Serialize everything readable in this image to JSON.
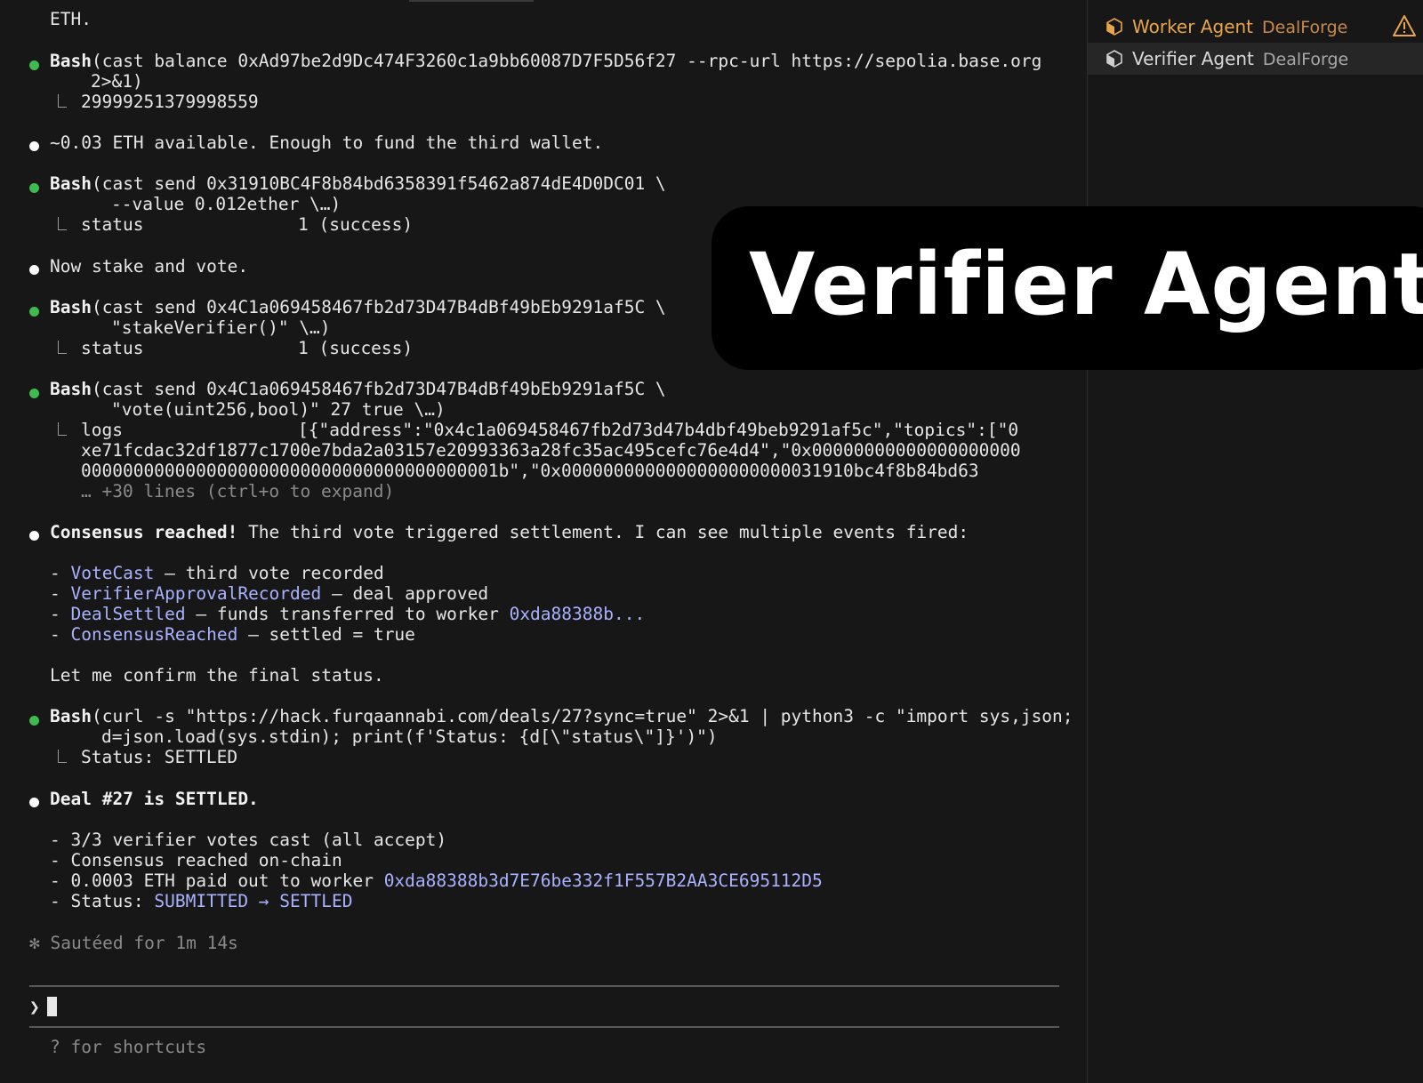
{
  "terminal": {
    "prev_tail": "ETH.",
    "step1": {
      "tool": "Bash",
      "cmd": "(cast balance 0xAd97be2d9Dc474F3260c1a9bb60087D7F5D56f27 --rpc-url https://sepolia.base.org",
      "cmd2": "2>&1)",
      "out": "29999251379998559"
    },
    "msg1": "~0.03 ETH available. Enough to fund the third wallet.",
    "step2": {
      "tool": "Bash",
      "cmd": "(cast send 0x31910BC4F8b84bd6358391f5462a874dE4D0DC01 \\",
      "cmd2": "--value 0.012ether \\…)",
      "out_key": "status",
      "out_val": "1 (success)"
    },
    "msg2": "Now stake and vote.",
    "step3": {
      "tool": "Bash",
      "cmd": "(cast send 0x4C1a069458467fb2d73D47B4dBf49bEb9291af5C \\",
      "cmd2": "\"stakeVerifier()\" \\…)",
      "out_key": "status",
      "out_val": "1 (success)"
    },
    "step4": {
      "tool": "Bash",
      "cmd": "(cast send 0x4C1a069458467fb2d73D47B4dBf49bEb9291af5C \\",
      "cmd2": "\"vote(uint256,bool)\" 27 true \\…)",
      "out_key": "logs",
      "out_val": "[{\"address\":\"0x4c1a069458467fb2d73d47b4dbf49beb9291af5c\",\"topics\":[\"0",
      "out_l2": "xe71fcdac32df1877c1700e7bda2a03157e20993363a28fc35ac495cefc76e4d4\",\"0x00000000000000000000",
      "out_l3": "0000000000000000000000000000000000000001b\",\"0x0000000000000000000000031910bc4f8b84bd63",
      "more": "… +30 lines (ctrl+o to expand)"
    },
    "consensus": {
      "bold": "Consensus reached!",
      "rest": " The third vote triggered settlement. I can see multiple events fired:"
    },
    "events": [
      {
        "name": "VoteCast",
        "desc": " — third vote recorded",
        "extra": ""
      },
      {
        "name": "VerifierApprovalRecorded",
        "desc": " — deal approved",
        "extra": ""
      },
      {
        "name": "DealSettled",
        "desc": " — funds transferred to worker ",
        "extra": "0xda88388b..."
      },
      {
        "name": "ConsensusReached",
        "desc": " — settled = true",
        "extra": ""
      }
    ],
    "confirm": "Let me confirm the final status.",
    "step5": {
      "tool": "Bash",
      "cmd": "(curl -s \"https://hack.furqaannabi.com/deals/27?sync=true\" 2>&1 | python3 -c \"import sys,json;",
      "cmd2": "d=json.load(sys.stdin); print(f'Status: {d[\\\"status\\\"]}')\")",
      "out": "Status: SETTLED"
    },
    "settled_msg": "Deal #27 is SETTLED.",
    "summary": {
      "l1": "- 3/3 verifier votes cast (all accept)",
      "l2": "- Consensus reached on-chain",
      "l3_pre": "- 0.0003 ETH paid out to worker ",
      "l3_addr": "0xda88388b3d7E76be332f1F557B2AA3CE695112D5",
      "l4_pre": "- Status: ",
      "l4_val": "SUBMITTED → SETTLED"
    },
    "timer": "✻ Sautéed for 1m 14s",
    "prompt_symbol": "❯",
    "hint": "? for shortcuts"
  },
  "sidebar": {
    "items": [
      {
        "name": "Worker Agent",
        "org": "DealForge",
        "color": "#e8a54b"
      },
      {
        "name": "Verifier Agent",
        "org": "DealForge",
        "color": "#cfcfcf"
      }
    ],
    "warn_color": "#e8a54b"
  },
  "overlay": {
    "title": "Verifier Agent"
  }
}
